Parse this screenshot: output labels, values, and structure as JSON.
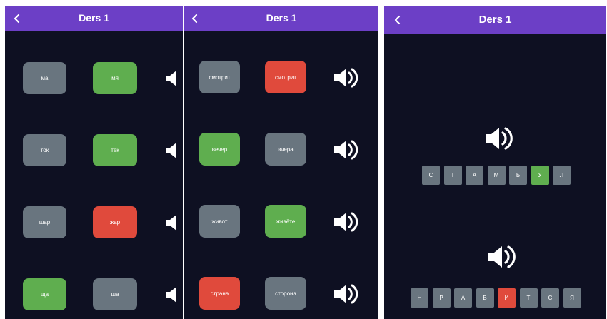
{
  "screens": [
    {
      "title": "Ders 1",
      "rows": [
        {
          "left": "ма",
          "left_state": "neutral",
          "right": "мя",
          "right_state": "correct"
        },
        {
          "left": "ток",
          "left_state": "neutral",
          "right": "тёк",
          "right_state": "correct"
        },
        {
          "left": "шар",
          "left_state": "neutral",
          "right": "жар",
          "right_state": "wrong"
        },
        {
          "left": "ща",
          "left_state": "correct",
          "right": "ша",
          "right_state": "neutral"
        }
      ]
    },
    {
      "title": "Ders 1",
      "rows": [
        {
          "left": "смотрит",
          "left_state": "neutral",
          "right": "смотрит",
          "right_state": "wrong"
        },
        {
          "left": "вечер",
          "left_state": "correct",
          "right": "вчера",
          "right_state": "neutral"
        },
        {
          "left": "живот",
          "left_state": "neutral",
          "right": "живёте",
          "right_state": "correct"
        },
        {
          "left": "страна",
          "left_state": "wrong",
          "right": "сторона",
          "right_state": "neutral"
        }
      ]
    },
    {
      "title": "Ders 1",
      "words": [
        {
          "letters": [
            "С",
            "Т",
            "А",
            "М",
            "Б",
            "У",
            "Л"
          ],
          "states": [
            "neutral",
            "neutral",
            "neutral",
            "neutral",
            "neutral",
            "correct",
            "neutral"
          ]
        },
        {
          "letters": [
            "Н",
            "Р",
            "А",
            "В",
            "И",
            "Т",
            "С",
            "Я"
          ],
          "states": [
            "neutral",
            "neutral",
            "neutral",
            "neutral",
            "wrong",
            "neutral",
            "neutral",
            "neutral"
          ]
        }
      ]
    }
  ],
  "colors": {
    "header": "#6c3fc6",
    "background": "#0e1022",
    "neutral": "#69757f",
    "correct": "#5fae4f",
    "wrong": "#e04a3c"
  },
  "icons": {
    "back": "chevron-left-icon",
    "audio": "speaker-icon"
  }
}
